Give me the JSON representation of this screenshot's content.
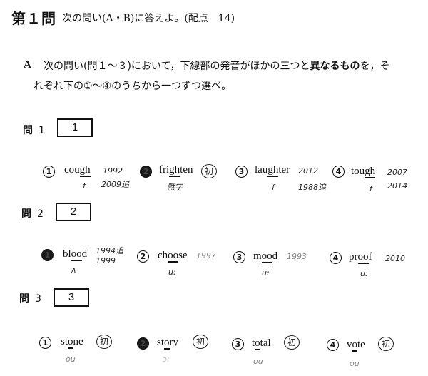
{
  "header": {
    "title": "第１問",
    "subtitle": "次の問い(A・B)に答えよ。(配点　14)"
  },
  "instructions": {
    "label": "A",
    "line1_pre": "次の問い(問１～３)において，下線部の発音がほかの三つと",
    "line1_bold": "異なるもの",
    "line1_post": "を，そ",
    "line2": "れぞれ下の①～④のうちから一つずつ選べ。"
  },
  "questions": [
    {
      "label": "問",
      "number": "1",
      "answer_box": "1",
      "choices": [
        {
          "num": "1",
          "selected": false,
          "pre": "cou",
          "underlined": "gh",
          "post": "",
          "note_top": "1992",
          "note_bottom": "2009追",
          "phonetic": "f"
        },
        {
          "num": "2",
          "selected": true,
          "pre": "fri",
          "underlined": "gh",
          "post": "ten",
          "note_circled": "初",
          "phonetic": "黙字"
        },
        {
          "num": "3",
          "selected": false,
          "pre": "lau",
          "underlined": "gh",
          "post": "ter",
          "note_top": "2012",
          "note_bottom": "1988追",
          "phonetic": "f"
        },
        {
          "num": "4",
          "selected": false,
          "pre": "tou",
          "underlined": "gh",
          "post": "",
          "note_top": "2007",
          "note_bottom": "2014",
          "phonetic": "f"
        }
      ]
    },
    {
      "label": "問",
      "number": "2",
      "answer_box": "2",
      "choices": [
        {
          "num": "1",
          "selected": true,
          "pre": "bl",
          "underlined": "oo",
          "post": "d",
          "note_top": "1994追",
          "note_bottom": "1999",
          "phonetic": "ʌ"
        },
        {
          "num": "2",
          "selected": false,
          "pre": "ch",
          "underlined": "oo",
          "post": "se",
          "note_top": "1997",
          "phonetic": "u:"
        },
        {
          "num": "3",
          "selected": false,
          "pre": "m",
          "underlined": "oo",
          "post": "d",
          "note_top": "1993",
          "phonetic": "u:"
        },
        {
          "num": "4",
          "selected": false,
          "pre": "pr",
          "underlined": "oo",
          "post": "f",
          "note_top": "2010",
          "phonetic": "u:"
        }
      ]
    },
    {
      "label": "問",
      "number": "3",
      "answer_box": "3",
      "choices": [
        {
          "num": "1",
          "selected": false,
          "pre": "st",
          "underlined": "o",
          "post": "ne",
          "note_circled": "初",
          "phonetic": "ou"
        },
        {
          "num": "2",
          "selected": true,
          "pre": "st",
          "underlined": "o",
          "post": "ry",
          "note_circled": "初",
          "phonetic": "ɔ:"
        },
        {
          "num": "3",
          "selected": false,
          "pre": "t",
          "underlined": "o",
          "post": "tal",
          "note_circled": "初",
          "phonetic": "ou"
        },
        {
          "num": "4",
          "selected": false,
          "pre": "v",
          "underlined": "o",
          "post": "te",
          "note_circled": "初",
          "phonetic": "ou"
        }
      ]
    }
  ]
}
